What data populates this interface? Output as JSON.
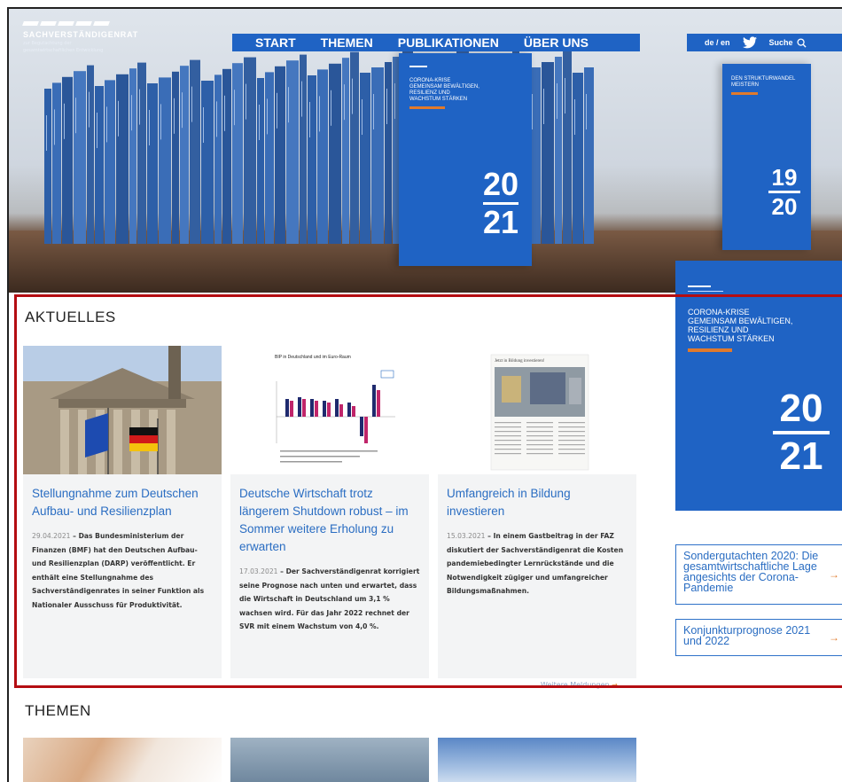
{
  "site": {
    "logo_name": "SACHVERSTÄNDIGENRAT",
    "logo_sub_1": "zur Begutachtung der",
    "logo_sub_2": "gesamtwirtschaftlichen Entwicklung"
  },
  "nav": {
    "items": [
      "START",
      "THEMEN",
      "PUBLIKATIONEN",
      "ÜBER UNS"
    ]
  },
  "utility": {
    "language": "de / en",
    "search_label": "Suche"
  },
  "hero": {
    "book1_lines": [
      "CORONA-KRISE",
      "GEMEINSAM BEWÄLTIGEN,",
      "RESILIENZ UND",
      "WACHSTUM STÄRKEN"
    ],
    "book1_year_top": "20",
    "book1_year_bottom": "21",
    "book2_lines": [
      "DEN STRUKTURWANDEL",
      "MEISTERN"
    ],
    "book2_year_top": "19",
    "book2_year_bottom": "20"
  },
  "aktuelles": {
    "heading": "AKTUELLES",
    "more_link": "Weitere Meldungen",
    "cards": [
      {
        "title": "Stellungnahme zum Deutschen Aufbau- und Resilienzplan",
        "date": "29.04.2021",
        "lead": " – Das Bundesministerium der Finanzen (BMF) hat den Deutschen Aufbau- und Resilienzplan (DARP) veröffentlicht. Er enthält eine Stellungnahme des Sachverständigenrates in seiner Funktion als Nationaler Ausschuss für Produktivität."
      },
      {
        "title": "Deutsche Wirtschaft trotz längerem Shutdown robust – im Sommer weitere Erholung zu erwarten",
        "date": "17.03.2021",
        "lead": " – Der Sachverständigenrat korrigiert seine Prognose nach unten und erwartet, dass die Wirtschaft in Deutschland um 3,1 % wachsen wird. Für das Jahr 2022 rechnet der SVR mit einem Wachstum von 4,0 %."
      },
      {
        "title": "Umfangreich in Bildung investieren",
        "date": "15.03.2021",
        "lead": " – In einem Gastbeitrag in der FAZ diskutiert der Sachverständigenrat die Kosten pandemiebedingter Lernrückstände und die Notwendigkeit zügiger und umfangreicher Bildungsmaßnahmen."
      }
    ],
    "chart_title": "BIP in Deutschland und im Euro-Raum",
    "article_title": "Jetzt in Bildung investieren!"
  },
  "sidebar": {
    "feature_lines": [
      "CORONA-KRISE",
      "GEMEINSAM BEWÄLTIGEN,",
      "RESILIENZ UND",
      "WACHSTUM STÄRKEN"
    ],
    "feature_year_top": "20",
    "feature_year_bottom": "21",
    "link1": "Sondergutachten 2020: Die gesamtwirtschaftliche Lage angesichts der Corona-Pandemie",
    "link2": "Konjunkturprognose 2021 und 2022",
    "arrow": "→"
  },
  "themen": {
    "heading": "THEMEN"
  },
  "colors": {
    "brand_blue": "#1f63c4",
    "accent_orange": "#e07a2c",
    "highlight_red": "#b40d12",
    "link_blue": "#2a6dc2"
  }
}
